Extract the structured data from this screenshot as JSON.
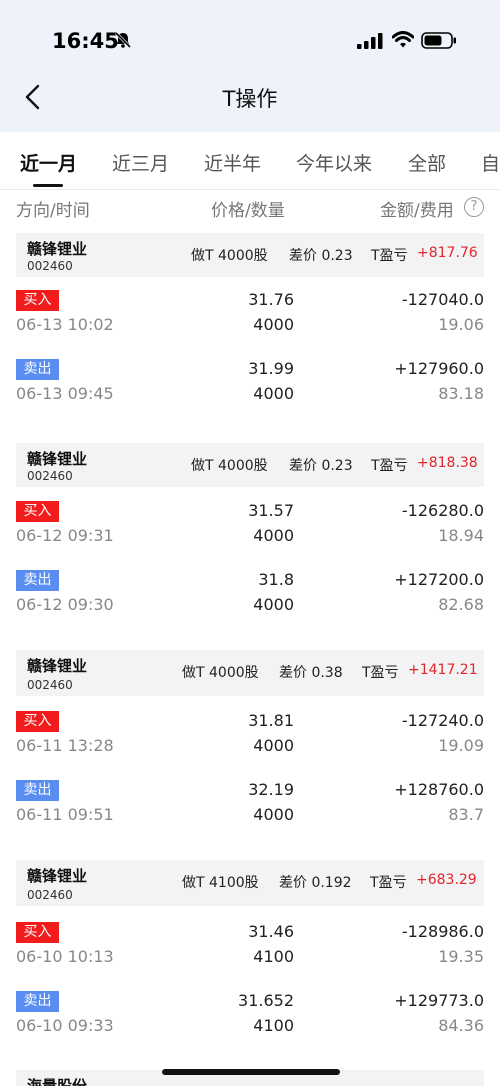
{
  "status_bar": {
    "time": "16:45"
  },
  "nav": {
    "title": "T操作"
  },
  "tabs": [
    {
      "label": "近一月",
      "active": true
    },
    {
      "label": "近三月",
      "active": false
    },
    {
      "label": "近半年",
      "active": false
    },
    {
      "label": "今年以来",
      "active": false
    },
    {
      "label": "全部",
      "active": false
    },
    {
      "label": "自",
      "active": false
    }
  ],
  "columns": {
    "direction_time": "方向/时间",
    "price_qty": "价格/数量",
    "amount_fee": "金额/费用",
    "help": "?"
  },
  "groups": [
    {
      "name": "赣锋锂业",
      "code": "002460",
      "t_label": "做T 4000股",
      "diff_label": "差价 0.23",
      "pl_label": "T盈亏",
      "pl_value": "+817.76",
      "trades": [
        {
          "type": "买入",
          "side": "buy",
          "time": "06-13 10:02",
          "price": "31.76",
          "qty": "4000",
          "amount": "-127040.0",
          "fee": "19.06"
        },
        {
          "type": "卖出",
          "side": "sell",
          "time": "06-13 09:45",
          "price": "31.99",
          "qty": "4000",
          "amount": "+127960.0",
          "fee": "83.18"
        }
      ]
    },
    {
      "name": "赣锋锂业",
      "code": "002460",
      "t_label": "做T 4000股",
      "diff_label": "差价 0.23",
      "pl_label": "T盈亏",
      "pl_value": "+818.38",
      "trades": [
        {
          "type": "买入",
          "side": "buy",
          "time": "06-12 09:31",
          "price": "31.57",
          "qty": "4000",
          "amount": "-126280.0",
          "fee": "18.94"
        },
        {
          "type": "卖出",
          "side": "sell",
          "time": "06-12 09:30",
          "price": "31.8",
          "qty": "4000",
          "amount": "+127200.0",
          "fee": "82.68"
        }
      ]
    },
    {
      "name": "赣锋锂业",
      "code": "002460",
      "t_label": "做T 4000股",
      "diff_label": "差价 0.38",
      "pl_label": "T盈亏",
      "pl_value": "+1417.21",
      "trades": [
        {
          "type": "买入",
          "side": "buy",
          "time": "06-11 13:28",
          "price": "31.81",
          "qty": "4000",
          "amount": "-127240.0",
          "fee": "19.09"
        },
        {
          "type": "卖出",
          "side": "sell",
          "time": "06-11 09:51",
          "price": "32.19",
          "qty": "4000",
          "amount": "+128760.0",
          "fee": "83.7"
        }
      ]
    },
    {
      "name": "赣锋锂业",
      "code": "002460",
      "t_label": "做T 4100股",
      "diff_label": "差价 0.192",
      "pl_label": "T盈亏",
      "pl_value": "+683.29",
      "trades": [
        {
          "type": "买入",
          "side": "buy",
          "time": "06-10 10:13",
          "price": "31.46",
          "qty": "4100",
          "amount": "-128986.0",
          "fee": "19.35"
        },
        {
          "type": "卖出",
          "side": "sell",
          "time": "06-10 09:33",
          "price": "31.652",
          "qty": "4100",
          "amount": "+129773.0",
          "fee": "84.36"
        }
      ]
    },
    {
      "name": "海量股份",
      "partial": true
    }
  ],
  "colors": {
    "profit": "#e0262a",
    "buy": "#f21c1c",
    "sell": "#5a8df0",
    "header_bg": "#eef2fa"
  }
}
